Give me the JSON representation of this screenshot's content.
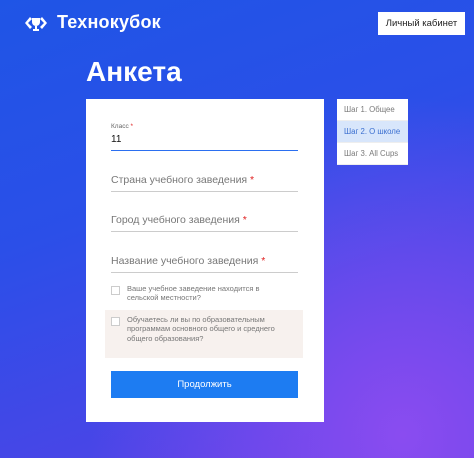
{
  "header": {
    "logo_text": "Технокубок",
    "cabinet_label": "Личный кабинет"
  },
  "page": {
    "title": "Анкета"
  },
  "form": {
    "class_field": {
      "label": "Класс",
      "required_mark": "*",
      "value": "11"
    },
    "school_country": {
      "placeholder": "Страна учебного заведения",
      "required_mark": "*"
    },
    "school_city": {
      "placeholder": "Город учебного заведения",
      "required_mark": "*"
    },
    "school_name": {
      "placeholder": "Название учебного заведения",
      "required_mark": "*"
    },
    "rural_checkbox": {
      "label": "Ваше учебное заведение находится в сельской местности?"
    },
    "program_checkbox": {
      "label": "Обучаетесь ли вы по образовательным программам основного общего и среднего общего образования?"
    },
    "submit_label": "Продолжить"
  },
  "steps": [
    {
      "label": "Шаг 1. Общее"
    },
    {
      "label": "Шаг 2. О школе"
    },
    {
      "label": "Шаг 3. All Cups"
    }
  ],
  "colors": {
    "accent": "#1d7cf2",
    "background_start": "#1f55e6",
    "background_end": "#8a4cf0"
  }
}
